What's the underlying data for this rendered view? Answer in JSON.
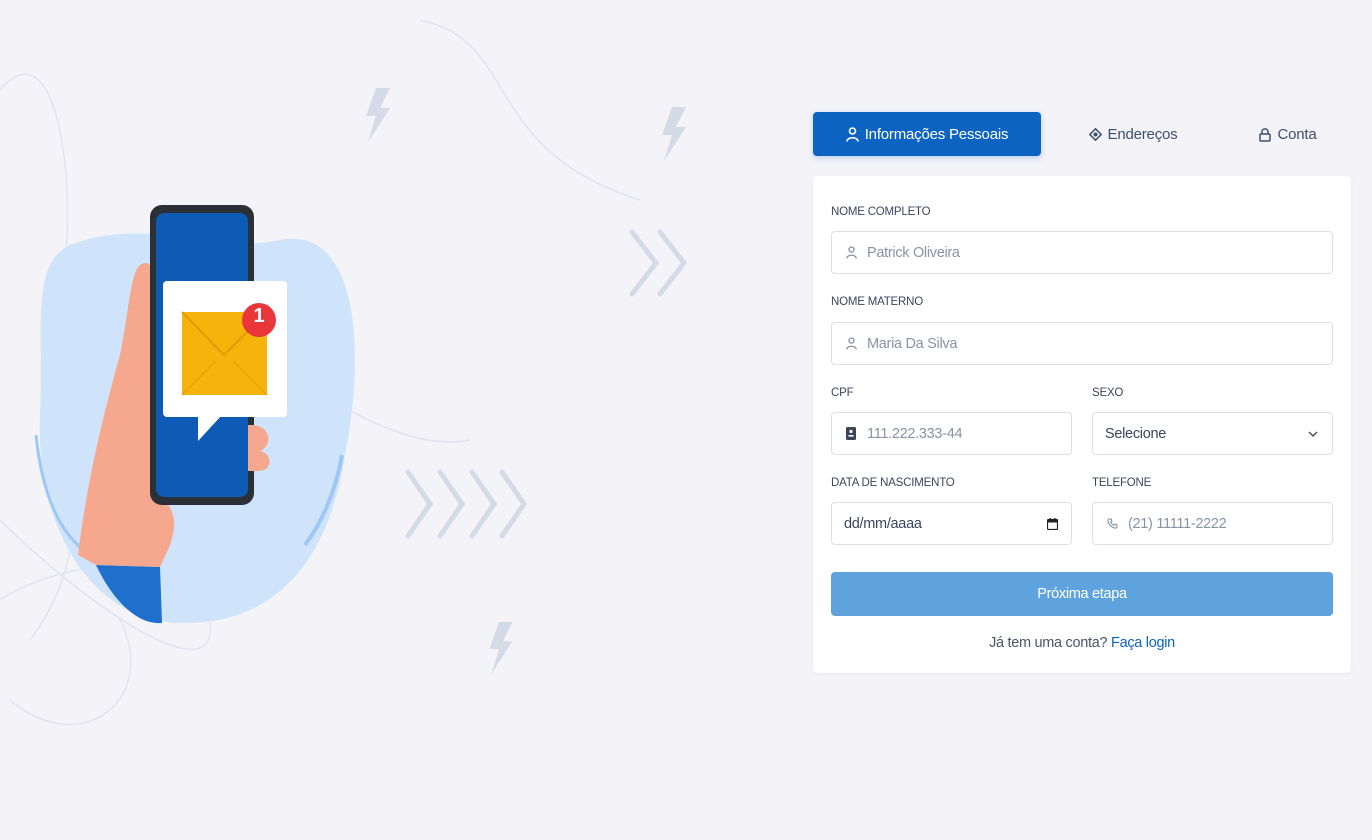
{
  "tabs": [
    {
      "label": "Informações Pessoais",
      "icon": "user-icon",
      "active": true
    },
    {
      "label": "Endereços",
      "icon": "location-icon",
      "active": false
    },
    {
      "label": "Conta",
      "icon": "lock-icon",
      "active": false
    }
  ],
  "form": {
    "nome_completo": {
      "label": "NOME COMPLETO",
      "placeholder": "Patrick Oliveira",
      "value": ""
    },
    "nome_materno": {
      "label": "NOME MATERNO",
      "placeholder": "Maria Da Silva",
      "value": ""
    },
    "cpf": {
      "label": "CPF",
      "placeholder": "111.222.333-44",
      "value": ""
    },
    "sexo": {
      "label": "SEXO",
      "selected": "Selecione"
    },
    "data_nascimento": {
      "label": "DATA DE NASCIMENTO",
      "display": "dd/mm/aaaa"
    },
    "telefone": {
      "label": "TELEFONE",
      "placeholder": "(21) 11111-2222",
      "value": ""
    }
  },
  "actions": {
    "next_label": "Próxima etapa",
    "login_prompt": "Já tem uma conta?",
    "login_link": "Faça login"
  },
  "colors": {
    "primary": "#0d63c2",
    "button": "#5ea3dd",
    "background": "#f3f3f8",
    "illustration_blob": "#cfe4fb"
  },
  "illustration": {
    "notification_count": "1"
  }
}
